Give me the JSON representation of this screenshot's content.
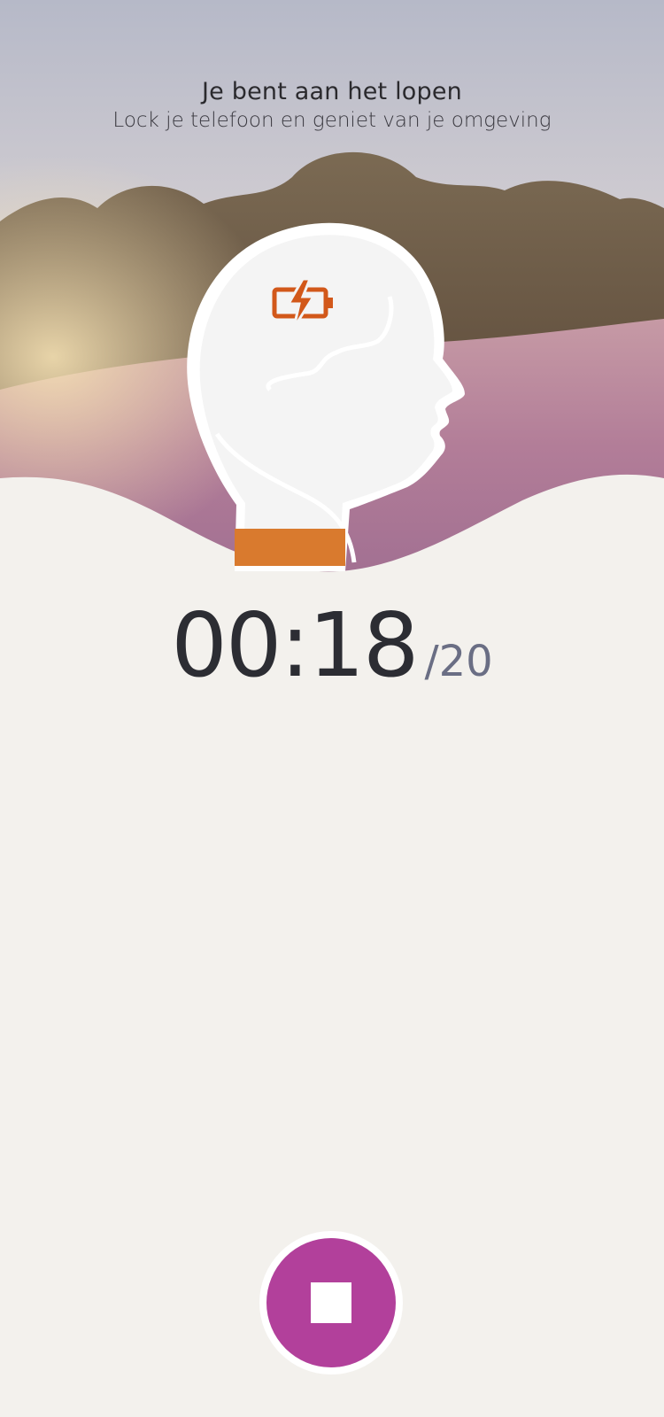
{
  "header": {
    "title": "Je bent aan het lopen",
    "subtitle": "Lock je telefoon en geniet van je omgeving"
  },
  "timer": {
    "elapsed": "00:18",
    "total": "/20"
  },
  "colors": {
    "accent_orange": "#d97a2e",
    "stop_button": "#b2409b",
    "background": "#f3f1ed"
  },
  "icons": {
    "head": "head-icon",
    "battery": "battery-charging-icon",
    "stop": "stop-icon"
  }
}
